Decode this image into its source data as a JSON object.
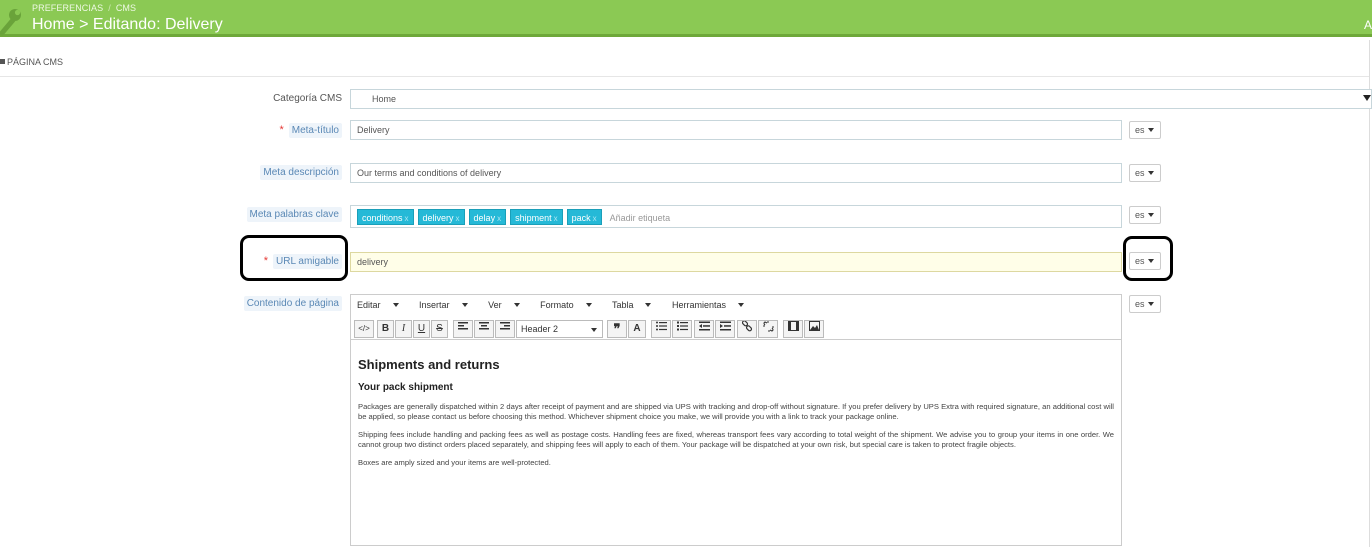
{
  "header": {
    "breadcrumb": [
      "PREFERENCIAS",
      "CMS"
    ],
    "breadcrumb_sep": "/",
    "title": "Home > Editando: Delivery",
    "right_edge": "A"
  },
  "panel": {
    "title": "PÁGINA CMS"
  },
  "form": {
    "categoria": {
      "label": "Categoría CMS",
      "value": "Home"
    },
    "meta_titulo": {
      "label": "Meta-título",
      "value": "Delivery",
      "lang": "es"
    },
    "meta_descripcion": {
      "label": "Meta descripción",
      "value": "Our terms and conditions of delivery",
      "lang": "es"
    },
    "meta_palabras": {
      "label": "Meta palabras clave",
      "tags": [
        "conditions",
        "delivery",
        "delay",
        "shipment",
        "pack"
      ],
      "placeholder": "Añadir etiqueta",
      "lang": "es"
    },
    "url": {
      "label": "URL amigable",
      "value": "delivery",
      "lang": "es"
    },
    "contenido": {
      "label": "Contenido de página",
      "lang": "es"
    },
    "required_mark": "*"
  },
  "editor": {
    "menus": [
      "Editar",
      "Insertar",
      "Ver",
      "Formato",
      "Tabla",
      "Herramientas"
    ],
    "format_select": "Header 2",
    "heading1": "Shipments and returns",
    "heading2": "Your pack shipment",
    "paragraphs": [
      "Packages are generally dispatched within 2 days after receipt of payment and are shipped via UPS with tracking and drop-off without signature. If you prefer delivery by UPS Extra with required signature, an additional cost will be applied, so please contact us before choosing this method. Whichever shipment choice you make, we will provide you with a link to track your package online.",
      "Shipping fees include handling and packing fees as well as postage costs. Handling fees are fixed, whereas transport fees vary according to total weight of the shipment. We advise you to group your items in one order. We cannot group two distinct orders placed separately, and shipping fees will apply to each of them. Your package will be dispatched at your own risk, but special care is taken to protect fragile objects.",
      "Boxes are amply sized and your items are well-protected."
    ]
  },
  "colors": {
    "header_bg": "#8bc954",
    "tag_bg": "#25b9d7",
    "highlight_field": "#fffee8"
  }
}
